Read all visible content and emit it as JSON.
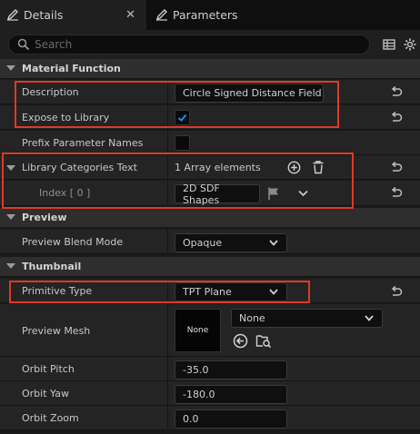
{
  "tabs": [
    {
      "label": "Details",
      "close": "✕"
    },
    {
      "label": "Parameters"
    }
  ],
  "search": {
    "placeholder": "Search"
  },
  "sections": {
    "material_function": "Material Function",
    "preview": "Preview",
    "thumbnail": "Thumbnail"
  },
  "props": {
    "description": {
      "label": "Description",
      "value": "Circle Signed Distance Field"
    },
    "expose_to_library": {
      "label": "Expose to Library",
      "checked": true
    },
    "prefix_parameter_names": {
      "label": "Prefix Parameter Names",
      "checked": false
    },
    "library_categories_text": {
      "label": "Library Categories Text",
      "value": "1 Array elements"
    },
    "index0": {
      "label": "Index [ 0 ]",
      "value": "2D SDF Shapes"
    },
    "preview_blend_mode": {
      "label": "Preview Blend Mode",
      "value": "Opaque"
    },
    "primitive_type": {
      "label": "Primitive Type",
      "value": "TPT Plane"
    },
    "preview_mesh": {
      "label": "Preview Mesh",
      "thumb_text": "None",
      "value": "None"
    },
    "orbit_pitch": {
      "label": "Orbit Pitch",
      "value": "-35.0"
    },
    "orbit_yaw": {
      "label": "Orbit Yaw",
      "value": "-180.0"
    },
    "orbit_zoom": {
      "label": "Orbit Zoom",
      "value": "0.0"
    }
  },
  "colors": {
    "accent": "#1f8eea",
    "highlight": "#e03a24"
  }
}
